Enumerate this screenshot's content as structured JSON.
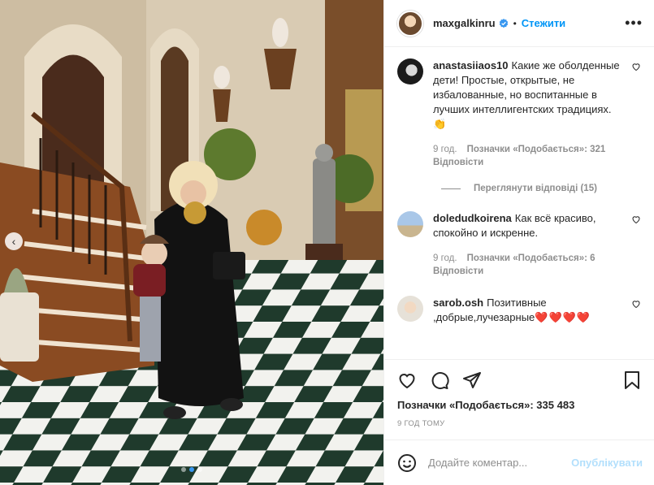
{
  "post": {
    "author": "maxgalkinru",
    "separator": "•",
    "follow_label": "Стежити",
    "more_label": "•••",
    "likes_text": "Позначки «Подобається»: 335 483",
    "time_ago": "9 год тому",
    "carousel": {
      "prev_label": "‹",
      "total_slides": 3,
      "active_slide": 1
    }
  },
  "comments": [
    {
      "user": "anastasiiaos10",
      "text": "Какие же оболденные дети! Простые, открытые, не избалованные, но воспитанные в лучших интеллигентских традициях.👏",
      "time": "9 год.",
      "likes": "Позначки «Подобається»: 321",
      "reply": "Відповісти"
    },
    {
      "user": "doledudkoirena",
      "text": "Как всё красиво, спокойно и искренне.",
      "time": "9 год.",
      "likes": "Позначки «Подобається»: 6",
      "reply": "Відповісти"
    },
    {
      "user": "sarob.osh",
      "text": "Позитивные ,добрые,лучезарные",
      "hearts": "❤️❤️❤️❤️"
    }
  ],
  "view_replies_label": "Переглянути відповіді (15)",
  "composer": {
    "placeholder": "Додайте коментар...",
    "publish_label": "Опублікувати"
  },
  "colors": {
    "accent": "#0095f6",
    "publish_disabled": "#b2dffc",
    "muted": "#8e8e8e",
    "text": "#262626",
    "like_heart": "#ed2d3a"
  },
  "icons": [
    "heart-icon",
    "comment-icon",
    "share-icon",
    "bookmark-icon",
    "emoji-icon",
    "verified-badge-icon",
    "more-icon"
  ]
}
